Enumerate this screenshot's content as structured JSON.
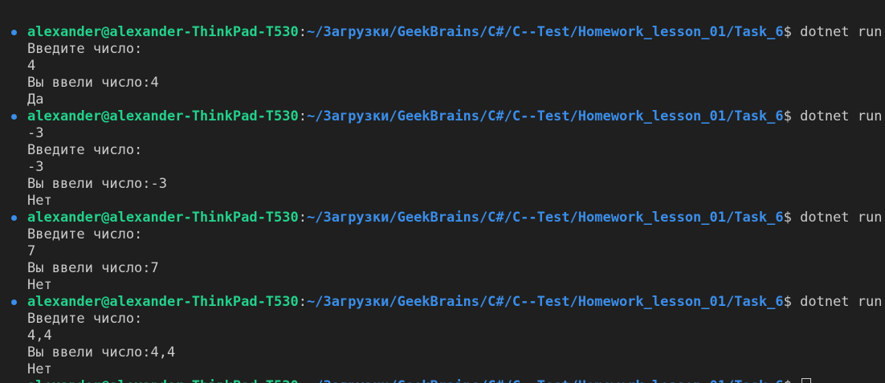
{
  "theme": {
    "background": "#1f1f1f",
    "foreground": "#cccccc",
    "user_color": "#23d18b",
    "path_color": "#3b8eea",
    "marker_color": "#3b8eea"
  },
  "prompt": {
    "user": "alexander@alexander-ThinkPad-T530",
    "separator": ":",
    "path": "~/Загрузки/GeekBrains/C#/C--Test/Homework_lesson_01/Task_6",
    "symbol": "$"
  },
  "lines": [
    {
      "type": "prompt",
      "command": " dotnet run"
    },
    {
      "type": "output",
      "text": "Введите число:"
    },
    {
      "type": "output",
      "text": "4"
    },
    {
      "type": "output",
      "text": "Вы ввели число:4"
    },
    {
      "type": "output",
      "text": "Да"
    },
    {
      "type": "prompt",
      "command": " dotnet run"
    },
    {
      "type": "output",
      "text": "-3"
    },
    {
      "type": "output",
      "text": "Введите число:"
    },
    {
      "type": "output",
      "text": "-3"
    },
    {
      "type": "output",
      "text": "Вы ввели число:-3"
    },
    {
      "type": "output",
      "text": "Нет"
    },
    {
      "type": "prompt",
      "command": " dotnet run"
    },
    {
      "type": "output",
      "text": "Введите число:"
    },
    {
      "type": "output",
      "text": "7"
    },
    {
      "type": "output",
      "text": "Вы ввели число:7"
    },
    {
      "type": "output",
      "text": "Нет"
    },
    {
      "type": "prompt",
      "command": " dotnet run"
    },
    {
      "type": "output",
      "text": "Введите число:"
    },
    {
      "type": "output",
      "text": "4,4"
    },
    {
      "type": "output",
      "text": "Вы ввели число:4,4"
    },
    {
      "type": "output",
      "text": "Нет"
    },
    {
      "type": "prompt",
      "command": " ",
      "cursor": true
    }
  ]
}
